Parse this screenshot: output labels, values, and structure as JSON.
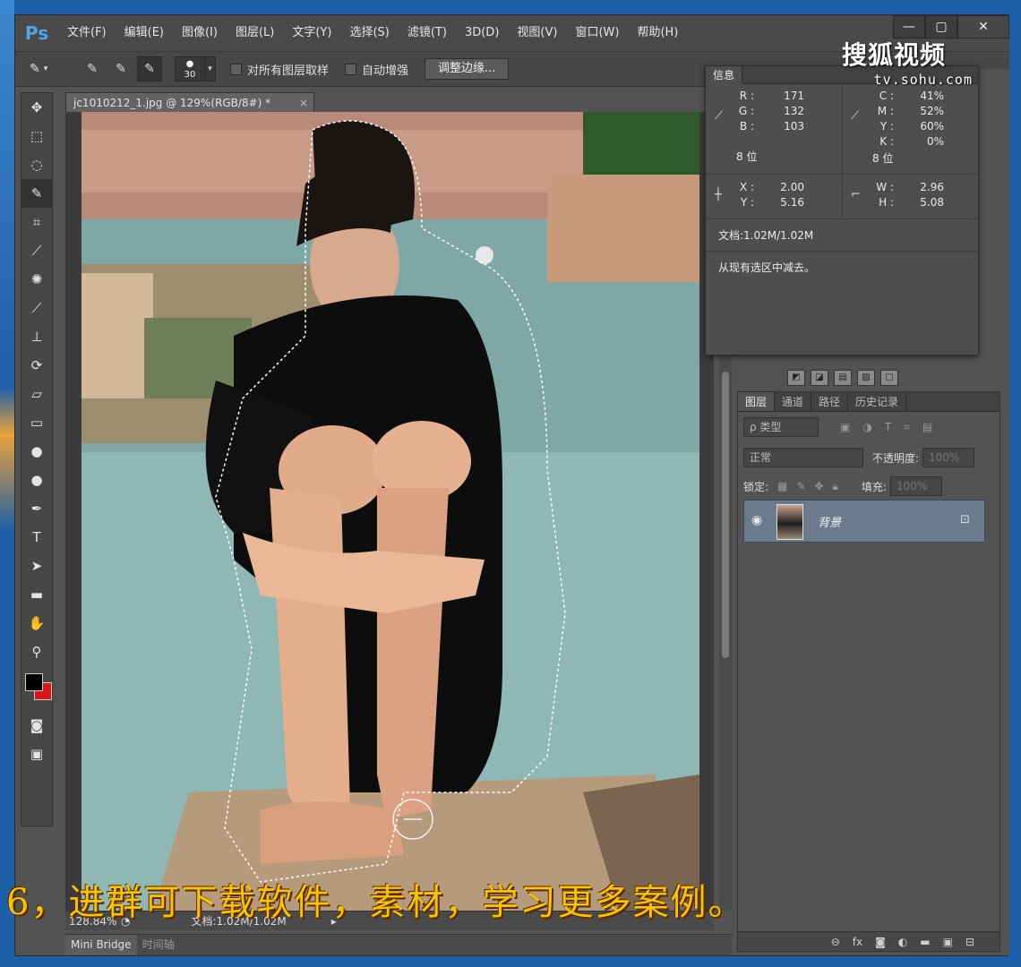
{
  "app": {
    "logo": "Ps",
    "menu": [
      "文件(F)",
      "编辑(E)",
      "图像(I)",
      "图层(L)",
      "文字(Y)",
      "选择(S)",
      "滤镜(T)",
      "3D(D)",
      "视图(V)",
      "窗口(W)",
      "帮助(H)"
    ],
    "window_controls": {
      "minimize": "—",
      "maximize": "▢",
      "close": "✕"
    }
  },
  "options": {
    "brush_size": "30",
    "sample_all_layers": "对所有图层取样",
    "auto_enhance": "自动增强",
    "refine_edge": "调整边缘..."
  },
  "document": {
    "tab_title": "jc1010212_1.jpg @ 129%(RGB/8#) *",
    "zoom": "128.84%",
    "doc_size": "文档:1.02M/1.02M"
  },
  "subtitle": "6，进群可下载软件，素材，学习更多案例。",
  "bottom_tabs": {
    "mini_bridge": "Mini Bridge",
    "timeline": "时间轴"
  },
  "info_panel": {
    "tab": "信息",
    "rgb": {
      "r_label": "R :",
      "g_label": "G :",
      "b_label": "B :",
      "r": "171",
      "g": "132",
      "b": "103",
      "bits": "8 位"
    },
    "cmyk": {
      "c_label": "C :",
      "m_label": "M :",
      "y_label": "Y :",
      "k_label": "K :",
      "c": "41%",
      "m": "52%",
      "y": "60%",
      "k": "0%",
      "bits": "8 位"
    },
    "xy": {
      "x_label": "X :",
      "y_label": "Y :",
      "x": "2.00",
      "y": "5.16"
    },
    "wh": {
      "w_label": "W :",
      "h_label": "H :",
      "w": "2.96",
      "h": "5.08"
    },
    "doc": "文档:1.02M/1.02M",
    "hint": "从现有选区中减去。"
  },
  "layers_panel": {
    "tabs": [
      "图层",
      "通道",
      "路径",
      "历史记录"
    ],
    "filter_kind": "ρ 类型",
    "blend_mode": "正常",
    "opacity_label": "不透明度:",
    "opacity_value": "100%",
    "lock_label": "锁定:",
    "fill_label": "填充:",
    "fill_value": "100%",
    "layer_name": "背景"
  },
  "watermark": {
    "brand": "搜狐视频",
    "url": "tv.sohu.com"
  }
}
